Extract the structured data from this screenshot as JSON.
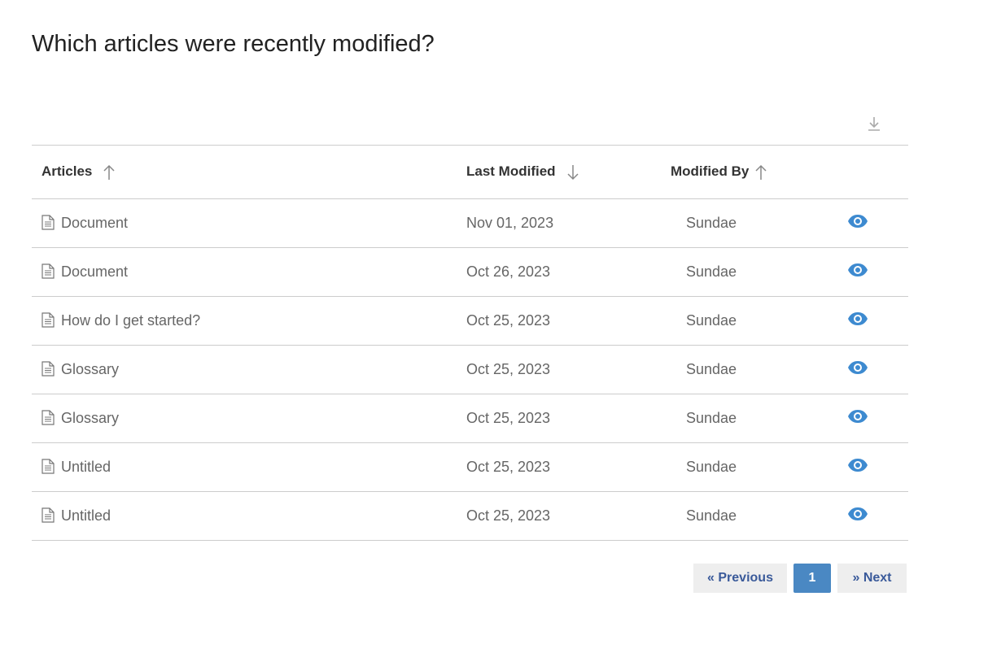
{
  "title": "Which articles were recently modified?",
  "icons": {
    "download": "download-icon",
    "doc": "document-icon",
    "view": "eye-icon"
  },
  "colors": {
    "accent": "#4a88c3",
    "eye": "#3d8ad0"
  },
  "columns": [
    {
      "label": "Articles",
      "sort": "ascending"
    },
    {
      "label": "Last Modified",
      "sort": "descending"
    },
    {
      "label": "Modified By",
      "sort": "ascending"
    }
  ],
  "rows": [
    {
      "article": "Document",
      "date": "Nov 01, 2023",
      "by": "Sundae"
    },
    {
      "article": "Document",
      "date": "Oct 26, 2023",
      "by": "Sundae"
    },
    {
      "article": "How do I get started?",
      "date": "Oct 25, 2023",
      "by": "Sundae"
    },
    {
      "article": "Glossary",
      "date": "Oct 25, 2023",
      "by": "Sundae"
    },
    {
      "article": "Glossary",
      "date": "Oct 25, 2023",
      "by": "Sundae"
    },
    {
      "article": "Untitled",
      "date": "Oct 25, 2023",
      "by": "Sundae"
    },
    {
      "article": "Untitled",
      "date": "Oct 25, 2023",
      "by": "Sundae"
    }
  ],
  "pagination": {
    "previous": "« Previous",
    "current": "1",
    "next": "» Next"
  }
}
